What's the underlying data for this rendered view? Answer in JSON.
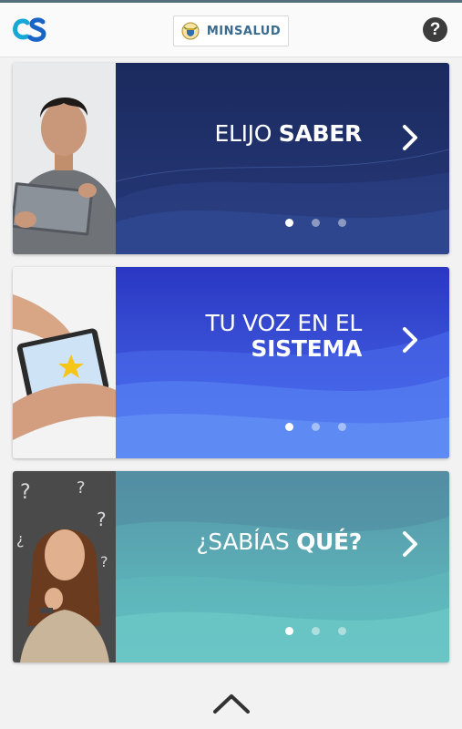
{
  "header": {
    "brand_label": "MINSALUD"
  },
  "cards": [
    {
      "title_light": "ELIJO ",
      "title_bold": "SABER"
    },
    {
      "title_line1": "TU VOZ EN EL",
      "title_line2": "SISTEMA"
    },
    {
      "title_light": "¿SABÍAS ",
      "title_bold": "QUÉ?"
    }
  ],
  "colors": {
    "topline": "#546e7a",
    "card1_panel": "#1f2f66",
    "card2_panel": "#3b50d8",
    "card3_panel": "#5aa9b2"
  },
  "icons": [
    "cs-logo-icon",
    "colombia-crest-icon",
    "help-icon",
    "chevron-right-icon",
    "chevron-up-icon"
  ]
}
